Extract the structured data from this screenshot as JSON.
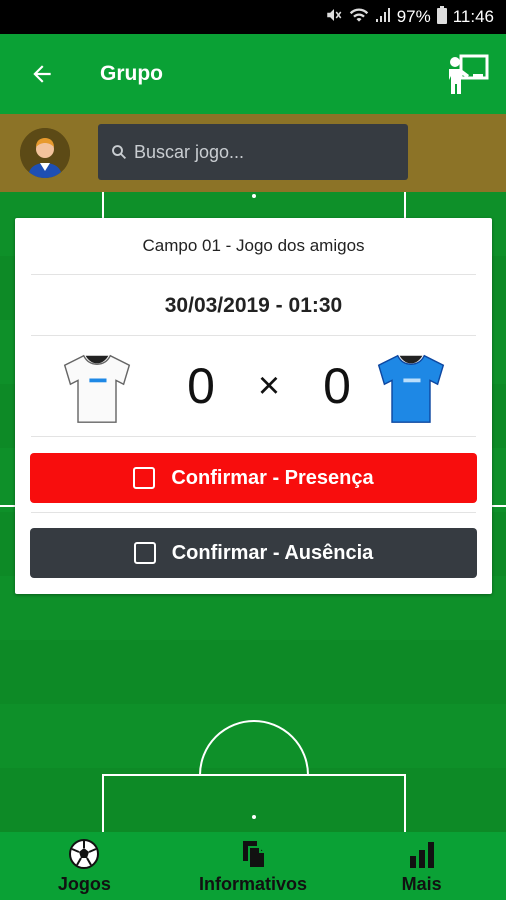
{
  "status": {
    "battery": "97%",
    "time": "11:46"
  },
  "header": {
    "title": "Grupo"
  },
  "search": {
    "placeholder": "Buscar jogo..."
  },
  "match": {
    "field": "Campo 01 - Jogo dos amigos",
    "datetime": "30/03/2019 - 01:30",
    "home_score": "0",
    "separator": "×",
    "away_score": "0"
  },
  "actions": {
    "confirm_presence": "Confirmar - Presença",
    "confirm_absence": "Confirmar - Ausência"
  },
  "nav": {
    "items": [
      {
        "label": "Jogos",
        "icon": "soccer-ball-icon"
      },
      {
        "label": "Informativos",
        "icon": "documents-icon"
      },
      {
        "label": "Mais",
        "icon": "bar-chart-icon"
      }
    ]
  },
  "colors": {
    "primary": "#0aa135",
    "field": "#0d8a26",
    "strip": "#8c7327",
    "confirm_red": "#f80d0d",
    "dark": "#363b41",
    "away_shirt": "#1e88e5"
  }
}
